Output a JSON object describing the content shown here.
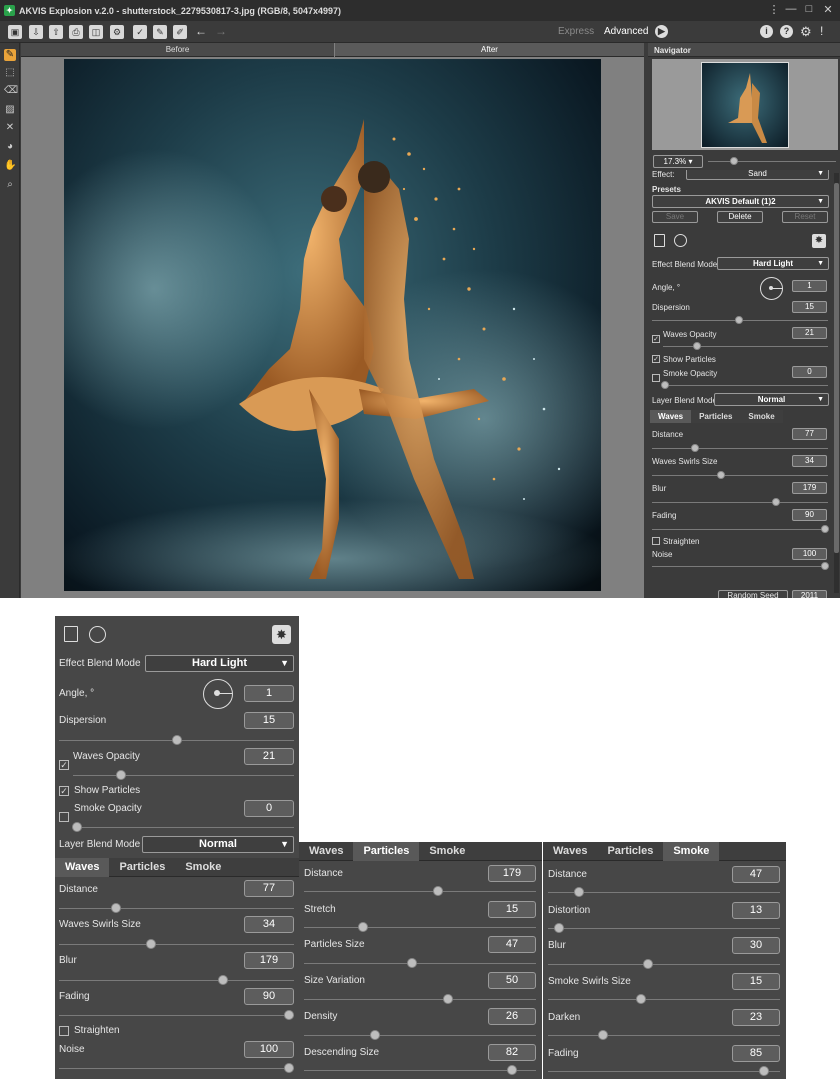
{
  "window": {
    "title": "AKVIS Explosion v.2.0 - shutterstock_2279530817-3.jpg (RGB/8, 5047x4997)",
    "minimize": "—",
    "maximize": "□",
    "close": "✕",
    "menu": "⋮"
  },
  "toolbar": {
    "mode_express": "Express",
    "mode_advanced": "Advanced",
    "icons": [
      "open-icon",
      "save-icon",
      "export-icon",
      "print-icon",
      "batch-icon",
      "settings-icon",
      "apply-icon",
      "brush-icon",
      "undo-icon",
      "redo-icon"
    ]
  },
  "canvas": {
    "tab_before": "Before",
    "tab_after": "After"
  },
  "navigator": {
    "title": "Navigator",
    "zoom": "17.3%"
  },
  "settings": {
    "effect_label": "Effect:",
    "effect_value": "Sand",
    "presets_label": "Presets",
    "preset_value": "AKVIS Default (1)2",
    "save_label": "Save",
    "delete_label": "Delete",
    "reset_label": "Reset",
    "effect_blend_label": "Effect Blend Mode",
    "effect_blend_value": "Hard Light",
    "angle_label": "Angle, °",
    "angle_value": "1",
    "dispersion_label": "Dispersion",
    "dispersion_value": "15",
    "waves_opacity_label": "Waves Opacity",
    "waves_opacity_value": "21",
    "show_particles_label": "Show Particles",
    "smoke_opacity_label": "Smoke Opacity",
    "smoke_opacity_value": "0",
    "layer_blend_label": "Layer Blend Mode",
    "layer_blend_value": "Normal",
    "random_seed_label": "Random Seed",
    "random_seed_value": "2011",
    "check_mark": "✓"
  },
  "tabs": {
    "waves": "Waves",
    "particles": "Particles",
    "smoke": "Smoke"
  },
  "waves": {
    "distance_label": "Distance",
    "distance_value": "77",
    "swirls_label": "Waves Swirls Size",
    "swirls_value": "34",
    "blur_label": "Blur",
    "blur_value": "179",
    "fading_label": "Fading",
    "fading_value": "90",
    "straighten_label": "Straighten",
    "noise_label": "Noise",
    "noise_value": "100"
  },
  "particles": {
    "distance_label": "Distance",
    "distance_value": "179",
    "stretch_label": "Stretch",
    "stretch_value": "15",
    "size_label": "Particles Size",
    "size_value": "47",
    "variation_label": "Size Variation",
    "variation_value": "50",
    "density_label": "Density",
    "density_value": "26",
    "descending_label": "Descending Size",
    "descending_value": "82"
  },
  "smoke": {
    "distance_label": "Distance",
    "distance_value": "47",
    "distortion_label": "Distortion",
    "distortion_value": "13",
    "blur_label": "Blur",
    "blur_value": "30",
    "swirls_label": "Smoke Swirls Size",
    "swirls_value": "15",
    "darken_label": "Darken",
    "darken_value": "23",
    "fading_label": "Fading",
    "fading_value": "85"
  }
}
